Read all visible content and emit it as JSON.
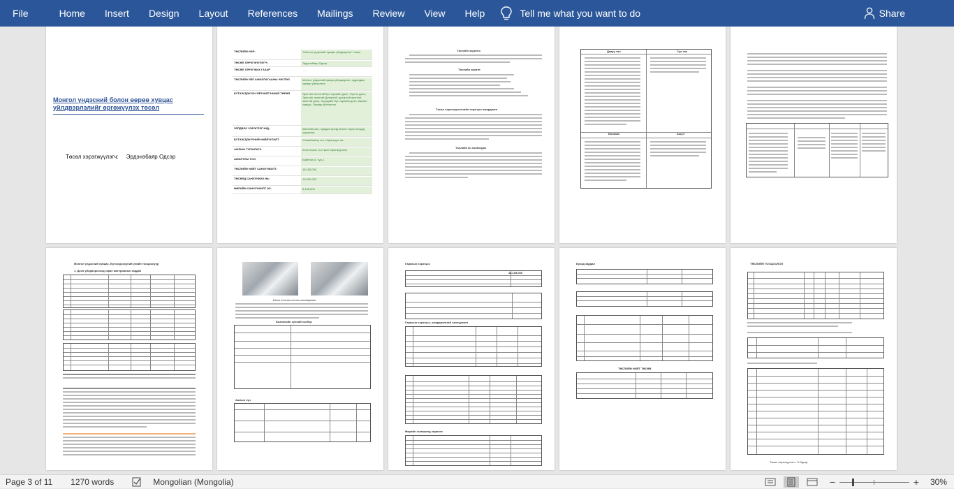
{
  "ribbon": {
    "tabs": [
      "File",
      "Home",
      "Insert",
      "Design",
      "Layout",
      "References",
      "Mailings",
      "Review",
      "View",
      "Help"
    ],
    "tell_me": "Tell me what you want to do",
    "share": "Share",
    "accent": "#2b579a"
  },
  "pages": {
    "p1": {
      "title": "Монгол үндэсний болон өөрөө хувцас үйлдвэрлэлийг өргөжүүлэх төсөл",
      "author_label": "Төсөл хэрэгжүүлэгч:",
      "author_name": "Эрдэнэбаяр Одсэр"
    },
    "p2": {
      "rows": [
        {
          "k": "ТӨСЛИЙН НЭР:",
          "v": "\"Монгол үндэсний хувцас үйлдвэрлэл\" төсөл"
        },
        {
          "k": "ТӨСӨЛ ХЭРЭГЖҮҮЛЭГЧ:",
          "v": "Эрдэнэбаяр Одсэр"
        },
        {
          "k": "ТӨСӨЛ ХЭРЭГЖИХ ГАЗАР",
          "v": "......"
        },
        {
          "k": "ТӨСЛИЙН ҮЙЛ АЖИЛЛАГААНЫ ЧИГЛЭЛ",
          "v": "Монгол үндэсний хувцас үйлдвэрлэл, худалдаа, засвар үйлчилгээ"
        },
        {
          "k": "БҮТЭЭГДЭХҮҮН ҮЙЛЧИЛГЭЭНИЙ ТӨРӨЛ",
          "v": "Эрэгтэй энгэлтэй бүх төрлийн дээл, Торгон дээл, Эрэгтэй, эмэгтэй Дотортой, дотортой эрэгтэй, эмэгтэй дээл, Хүүхдийн бүх төрлийн дээл, Ажлын хувцас, Засвар үйлчилгээ"
        },
        {
          "k": "ҮЙЛДВЭР ХЭРЭГЛЭГЧИД:",
          "v": "Айлчийн хөл, сумдын иргэд болон хэрэглэгчдэд зориулна."
        },
        {
          "k": "БҮТЭЭГДЭХҮҮНИЙ НИЙЛҮҮЛЭЛТ",
          "v": "Улаанбаатар хот, Нарангуул аж"
        },
        {
          "k": "АЖЛЫН ТУРШЛАГА",
          "v": "2010 оноос 11,2 жил хэрэгжүүлсэн"
        },
        {
          "k": "АЖИЛТНЫ ТОО",
          "v": "Байнгын-3, түр-1"
        },
        {
          "k": "ТӨСЛИЙН НИЙТ САНХҮҮЖИЛТ:",
          "v": "18,105,000"
        },
        {
          "k": "ТӨСӨЛД САНХҮҮЖИХ НЬ:",
          "v": "15,000,000"
        },
        {
          "k": "ӨӨРИЙН САНХҮҮЖИЛТ ЭЗ:",
          "v": "3,105,000"
        }
      ]
    },
    "p3": {
      "h1": "Төслийн зорилго",
      "h2": "Төслийн зорилт",
      "h3": "Төсөл хэрэгжүүлэгчийн хэрэгцээ шаардлага",
      "h4": "Төслийн ач холбогдол"
    },
    "p4": {
      "heads": [
        "Давуу тал",
        "Сул тал",
        "Боломж",
        "Аюул"
      ]
    },
    "p6": {
      "title": "Монгол үндэсний хувцас, Бүтээгдэхүүний үнийн тооцоолуур",
      "sub1": "1. Дээл үйлдвэрлэхэд гарах материалын зардал"
    },
    "p7": {
      "caption": "Шинэ техник тоног төхөөрөмж",
      "t1_head": "Бизнесийн хүчний хэлбэр",
      "t2_head": "Ажлын хүч"
    },
    "p8": {
      "h1": "Гарахын хэрэгцээ",
      "h2": "Гарахын хэрэгцээ, шаардлагатай санхүүжилт",
      "h3": "Өөрийн эзэмшилд хөрөнгө",
      "total1": "18,105,000"
    },
    "p9": {
      "h1": "Бусад зардал",
      "h2": "ТӨСЛИЙН НИЙТ ТӨСӨВ"
    },
    "p10": {
      "h1": "ТӨСЛИЙН ТООЦООЛОЛ",
      "sign": "Төсөл хэрэгжүүлэгч:       Э.Одсэр"
    }
  },
  "status": {
    "page": "Page 3 of 11",
    "words": "1270 words",
    "language": "Mongolian (Mongolia)",
    "zoom": "30%"
  }
}
